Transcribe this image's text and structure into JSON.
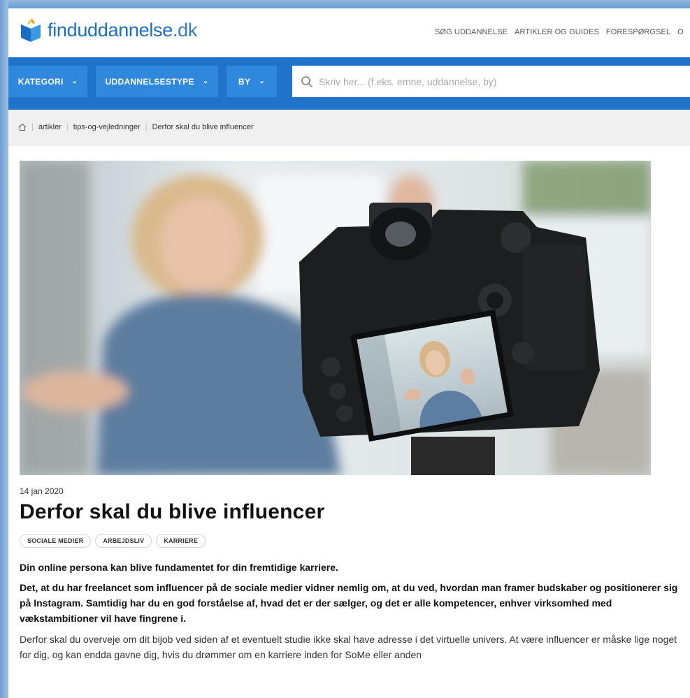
{
  "site": {
    "logo_text": "finduddannelse",
    "logo_tld": ".dk"
  },
  "topnav": [
    "SØG UDDANNELSE",
    "ARTIKLER OG GUIDES",
    "FORESPØRGSEL",
    "O"
  ],
  "filters": {
    "kategori": "KATEGORI",
    "uddannelsestype": "UDDANNELSESTYPE",
    "by": "BY"
  },
  "search": {
    "placeholder": "Skriv her... (f.eks. emne, uddannelse, by)"
  },
  "breadcrumb": {
    "items": [
      "artikler",
      "tips-og-vejledninger",
      "Derfor skal du blive influencer"
    ]
  },
  "article": {
    "date": "14 jan 2020",
    "title": "Derfor skal du blive influencer",
    "tags": [
      "SOCIALE MEDIER",
      "ARBEJDSLIV",
      "KARRIERE"
    ],
    "lead": "Din online persona kan blive fundamentet for din fremtidige karriere.",
    "bold_paragraph": "Det, at du har freelancet som influencer på de sociale medier vidner nemlig om, at du ved, hvordan man framer budskaber og positionerer sig på Instagram. Samtidig har du en god forståelse af, hvad det er der sælger, og det er alle kompetencer, enhver virksomhed med vækstambitioner vil have fingrene i.",
    "paragraph": "Derfor skal du overveje om dit bijob ved siden af et eventuelt studie ikke skal have adresse i det virtuelle univers. At være influencer er måske lige noget for dig, og kan endda gavne dig, hvis du drømmer om en karriere inden for SoMe eller anden"
  },
  "colors": {
    "brand_blue": "#1f73c8",
    "filter_blue": "#2f88dc",
    "logo_blue": "#1a6fc4"
  }
}
